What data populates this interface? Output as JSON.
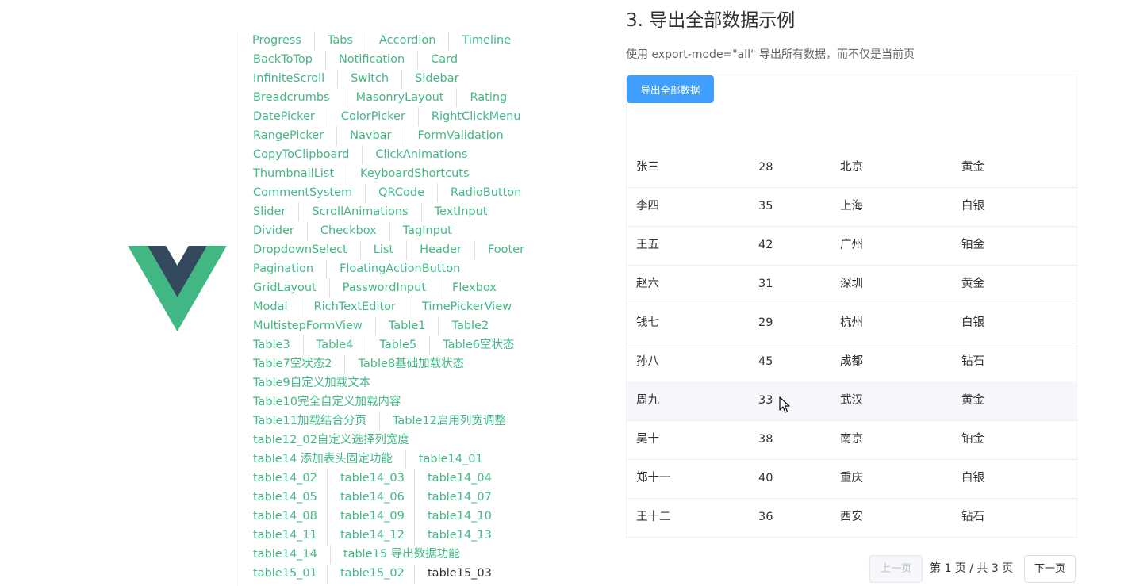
{
  "nav": {
    "rows": [
      [
        "Progress",
        "Tabs",
        "Accordion",
        "Timeline"
      ],
      [
        "BackToTop",
        "Notification",
        "Card"
      ],
      [
        "InfiniteScroll",
        "Switch",
        "Sidebar"
      ],
      [
        "Breadcrumbs",
        "MasonryLayout",
        "Rating"
      ],
      [
        "DatePicker",
        "ColorPicker",
        "RightClickMenu"
      ],
      [
        "RangePicker",
        "Navbar",
        "FormValidation"
      ],
      [
        "CopyToClipboard",
        "ClickAnimations"
      ],
      [
        "ThumbnailList",
        "KeyboardShortcuts"
      ],
      [
        "CommentSystem",
        "QRCode",
        "RadioButton"
      ],
      [
        "Slider",
        "ScrollAnimations",
        "TextInput"
      ],
      [
        "Divider",
        "Checkbox",
        "TagInput"
      ],
      [
        "DropdownSelect",
        "List",
        "Header",
        "Footer"
      ],
      [
        "Pagination",
        "FloatingActionButton"
      ],
      [
        "GridLayout",
        "PasswordInput",
        "Flexbox"
      ],
      [
        "Modal",
        "RichTextEditor",
        "TimePickerView"
      ],
      [
        "MultistepFormView",
        "Table1",
        "Table2"
      ],
      [
        "Table3",
        "Table4",
        "Table5",
        "Table6空状态"
      ],
      [
        "Table7空状态2",
        "Table8基础加载状态"
      ],
      [
        "Table9自定义加载文本"
      ],
      [
        "Table10完全自定义加载内容"
      ],
      [
        "Table11加载结合分页",
        "Table12启用列宽调整"
      ],
      [
        "table12_02自定义选择列宽度"
      ],
      [
        "table14 添加表头固定功能",
        "table14_01"
      ],
      [
        "table14_02",
        "table14_03",
        "table14_04"
      ],
      [
        "table14_05",
        "table14_06",
        "table14_07"
      ],
      [
        "table14_08",
        "table14_09",
        "table14_10"
      ],
      [
        "table14_11",
        "table14_12",
        "table14_13"
      ],
      [
        "table14_14",
        "table15 导出数据功能"
      ],
      [
        "table15_01",
        "table15_02",
        "table15_03"
      ]
    ],
    "current": "table15_03"
  },
  "section": {
    "title": "3. 导出全部数据示例",
    "description": "使用 export-mode=\"all\" 导出所有数据，而不仅是当前页"
  },
  "export_button": "导出全部数据",
  "table": {
    "rows": [
      [
        "张三",
        "28",
        "北京",
        "黄金"
      ],
      [
        "李四",
        "35",
        "上海",
        "白银"
      ],
      [
        "王五",
        "42",
        "广州",
        "铂金"
      ],
      [
        "赵六",
        "31",
        "深圳",
        "黄金"
      ],
      [
        "钱七",
        "29",
        "杭州",
        "白银"
      ],
      [
        "孙八",
        "45",
        "成都",
        "钻石"
      ],
      [
        "周九",
        "33",
        "武汉",
        "黄金"
      ],
      [
        "吴十",
        "38",
        "南京",
        "铂金"
      ],
      [
        "郑十一",
        "40",
        "重庆",
        "白银"
      ],
      [
        "王十二",
        "36",
        "西安",
        "钻石"
      ]
    ],
    "hover_row": 6
  },
  "pagination": {
    "prev": "上一页",
    "info": "第 1 页 / 共 3 页",
    "next": "下一页"
  },
  "colors": {
    "link": "#42b983",
    "primary": "#409eff",
    "logo_green": "#41b883",
    "logo_dark": "#35495e"
  }
}
